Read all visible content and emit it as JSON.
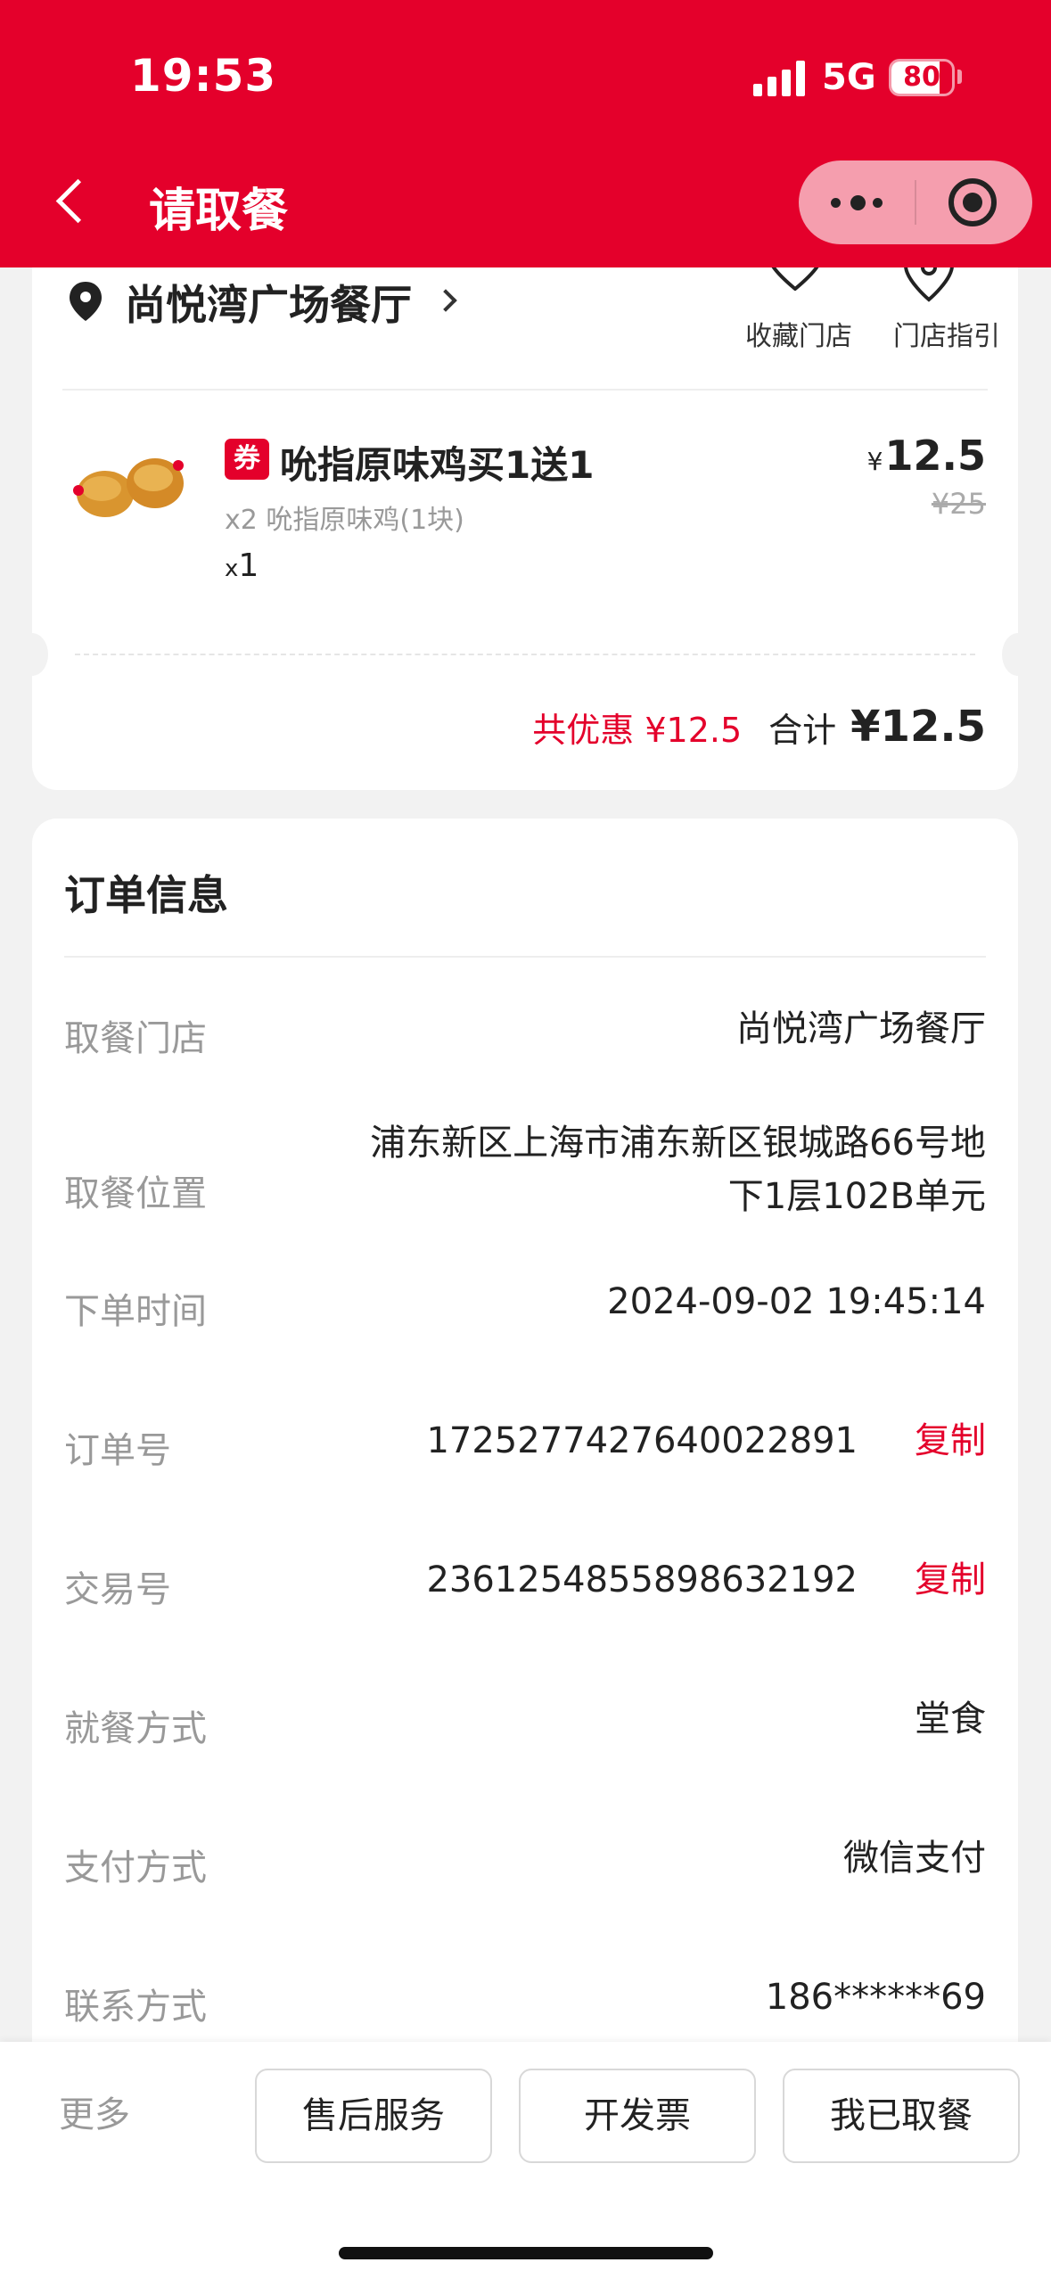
{
  "status_bar": {
    "time": "19:53",
    "network": "5G",
    "battery": "80",
    "battery_level": 0.8
  },
  "header": {
    "title": "请取餐",
    "bg_color": "#e4002b"
  },
  "store": {
    "name": "尚悦湾广场餐厅",
    "favorite_label": "收藏门店",
    "guide_label": "门店指引"
  },
  "item": {
    "badge": "券",
    "title": "吮指原味鸡买1送1",
    "description": "x2 吮指原味鸡(1块)",
    "qty_prefix": "x",
    "qty": "1",
    "currency": "¥",
    "price": "12.5",
    "original_price": "¥25"
  },
  "summary": {
    "discount": "共优惠 ¥12.5",
    "total_label": "合计",
    "total": "¥12.5"
  },
  "order_info": {
    "title": "订单信息",
    "copy_label": "复制",
    "rows": [
      {
        "label": "取餐门店",
        "value": "尚悦湾广场餐厅"
      },
      {
        "label": "取餐位置",
        "value": "浦东新区上海市浦东新区银城路66号地下1层102B单元"
      },
      {
        "label": "下单时间",
        "value": "2024-09-02 19:45:14"
      },
      {
        "label": "订单号",
        "value": "1725277427640022891"
      },
      {
        "label": "交易号",
        "value": "2361254855898632192"
      },
      {
        "label": "就餐方式",
        "value": "堂食"
      },
      {
        "label": "支付方式",
        "value": "微信支付"
      },
      {
        "label": "联系方式",
        "value": "186******69"
      }
    ]
  },
  "bottom_bar": {
    "more": "更多",
    "buttons": [
      "售后服务",
      "开发票",
      "我已取餐"
    ]
  },
  "colors": {
    "accent": "#e4002b",
    "muted_text": "#999999",
    "background": "#f2f2f2"
  }
}
